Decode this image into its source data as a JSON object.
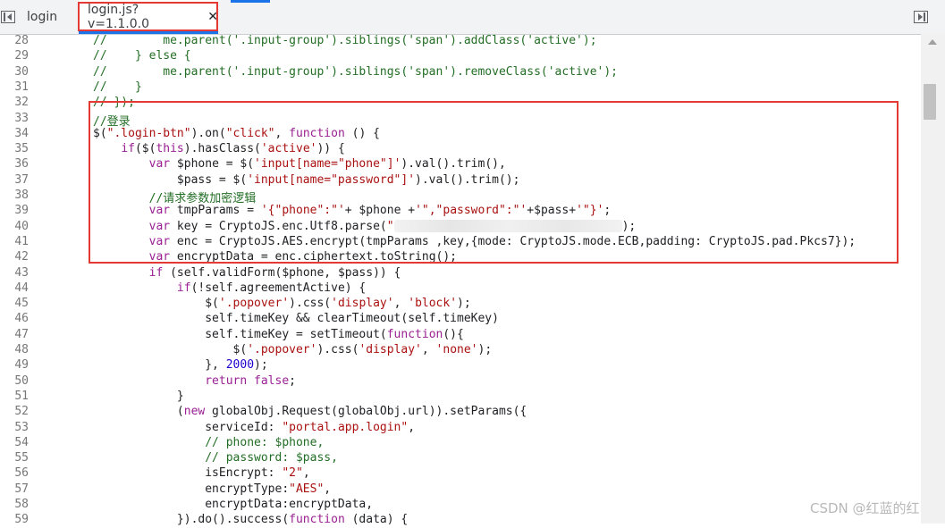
{
  "tabs": {
    "login_label": "login",
    "active_label": "login.js?v=1.1.0.0",
    "close_glyph": "✕"
  },
  "lines": [
    {
      "n": "28",
      "html": "<span class=\"cmt\">//        me.parent('.input-group').siblings('span').addClass('active');</span>"
    },
    {
      "n": "29",
      "html": "<span class=\"cmt\">//    } else {</span>"
    },
    {
      "n": "30",
      "html": "<span class=\"cmt\">//        me.parent('.input-group').siblings('span').removeClass('active');</span>"
    },
    {
      "n": "31",
      "html": "<span class=\"cmt\">//    }</span>"
    },
    {
      "n": "32",
      "html": "<span class=\"cmt\">// });</span>"
    },
    {
      "n": "33",
      "html": "<span class=\"cmt\">//登录</span>"
    },
    {
      "n": "34",
      "html": "$(<span class=\"str\">\".login-btn\"</span>).on(<span class=\"str\">\"click\"</span>, <span class=\"kw\">function</span> () {"
    },
    {
      "n": "35",
      "html": "    <span class=\"kw\">if</span>($(<span class=\"kw\">this</span>).hasClass(<span class=\"str\">'active'</span>)) {"
    },
    {
      "n": "36",
      "html": "        <span class=\"kw\">var</span> $phone = $(<span class=\"str\">'input[name=\"phone\"]'</span>).val().trim(),"
    },
    {
      "n": "37",
      "html": "            $pass = $(<span class=\"str\">'input[name=\"password\"]'</span>).val().trim();"
    },
    {
      "n": "38",
      "html": "        <span class=\"cmt\">//请求参数加密逻辑</span>"
    },
    {
      "n": "39",
      "html": "        <span class=\"kw\">var</span> tmpParams = <span class=\"str\">'{\"phone\":\"'</span>+ $phone +<span class=\"str\">'\",\"password\":\"'</span>+$pass+<span class=\"str\">'\"}'</span>;"
    },
    {
      "n": "40",
      "html": "        <span class=\"kw\">var</span> key = CryptoJS.enc.Utf8.parse(<span class=\"str\">\"</span><span class=\"blur\"></span>);"
    },
    {
      "n": "41",
      "html": "        <span class=\"kw\">var</span> enc = CryptoJS.AES.encrypt(tmpParams ,key,{mode: CryptoJS.mode.ECB,padding: CryptoJS.pad.Pkcs7});"
    },
    {
      "n": "42",
      "html": "        <span class=\"kw\">var</span> encryptData = enc.ciphertext.toString();"
    },
    {
      "n": "43",
      "html": "        <span class=\"kw\">if</span> (self.validForm($phone, $pass)) {"
    },
    {
      "n": "44",
      "html": "            <span class=\"kw\">if</span>(!self.agreementActive) {"
    },
    {
      "n": "45",
      "html": "                $(<span class=\"str\">'.popover'</span>).css(<span class=\"str\">'display'</span>, <span class=\"str\">'block'</span>);"
    },
    {
      "n": "46",
      "html": "                self.timeKey &amp;&amp; clearTimeout(self.timeKey)"
    },
    {
      "n": "47",
      "html": "                self.timeKey = setTimeout(<span class=\"kw\">function</span>(){"
    },
    {
      "n": "48",
      "html": "                    $(<span class=\"str\">'.popover'</span>).css(<span class=\"str\">'display'</span>, <span class=\"str\">'none'</span>);"
    },
    {
      "n": "49",
      "html": "                }, <span class=\"num\">2000</span>);"
    },
    {
      "n": "50",
      "html": "                <span class=\"kw\">return</span> <span class=\"kw\">false</span>;"
    },
    {
      "n": "51",
      "html": "            }"
    },
    {
      "n": "52",
      "html": "            (<span class=\"kw\">new</span> globalObj.Request(globalObj.url)).setParams({"
    },
    {
      "n": "53",
      "html": "                serviceId: <span class=\"str\">\"portal.app.login\"</span>,"
    },
    {
      "n": "54",
      "html": "                <span class=\"cmt\">// phone: $phone,</span>"
    },
    {
      "n": "55",
      "html": "                <span class=\"cmt\">// password: $pass,</span>"
    },
    {
      "n": "56",
      "html": "                isEncrypt: <span class=\"str\">\"2\"</span>,"
    },
    {
      "n": "57",
      "html": "                encryptType:<span class=\"str\">\"AES\"</span>,"
    },
    {
      "n": "58",
      "html": "                encryptData:encryptData,"
    },
    {
      "n": "59",
      "html": "            }).do().success(<span class=\"kw\">function</span> (data) {"
    }
  ],
  "watermark": "CSDN @红蓝的红",
  "colors": {
    "comment": "#236e25",
    "string": "#a11",
    "keyword": "#9a2093",
    "number": "#1c00cf",
    "highlight_box": "#e53935",
    "active_tab_accent": "#1a73e8"
  }
}
